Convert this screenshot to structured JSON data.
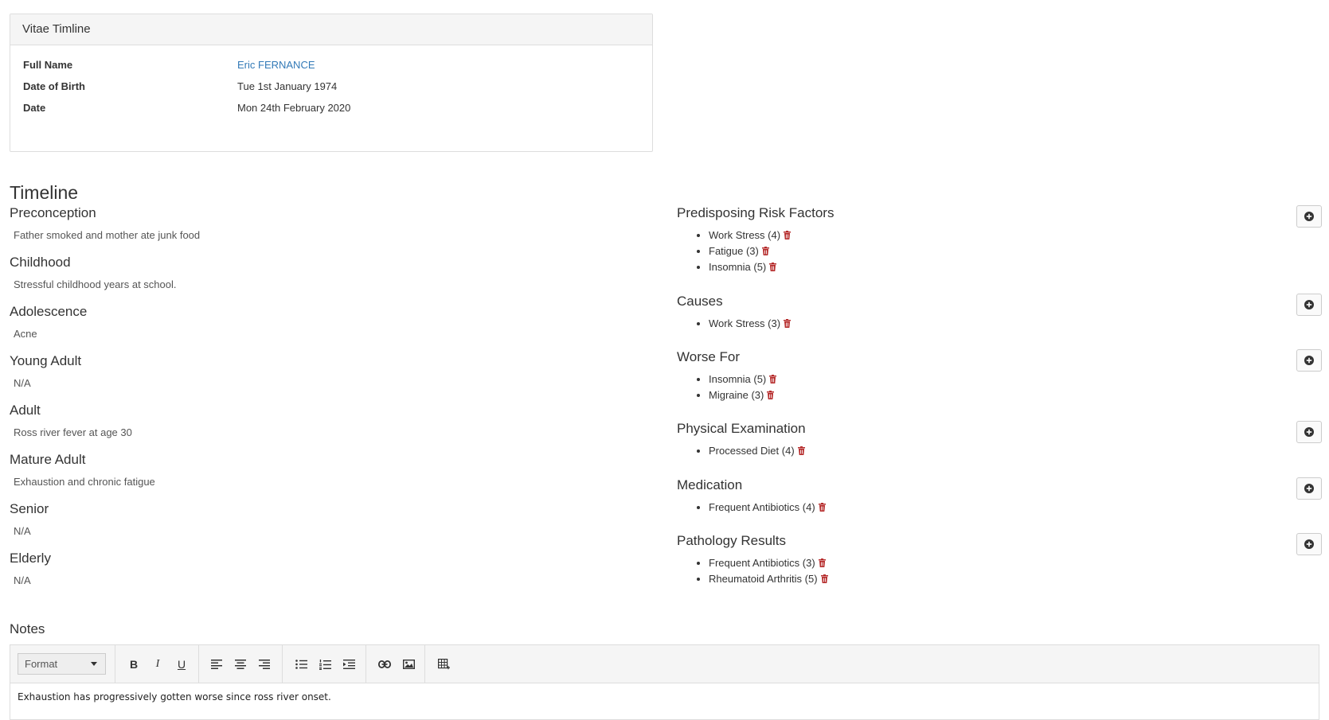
{
  "panel": {
    "title": "Vitae Timline",
    "rows": [
      {
        "label": "Full Name",
        "value": "Eric FERNANCE"
      },
      {
        "label": "Date of Birth",
        "value": "Tue 1st January 1974"
      },
      {
        "label": "Date",
        "value": "Mon 24th February 2020"
      }
    ]
  },
  "timeline": {
    "title": "Timeline",
    "stages": [
      {
        "title": "Preconception",
        "text": "Father smoked and mother ate junk food"
      },
      {
        "title": "Childhood",
        "text": "Stressful childhood years at school."
      },
      {
        "title": "Adolescence",
        "text": "Acne"
      },
      {
        "title": "Young Adult",
        "text": "N/A"
      },
      {
        "title": "Adult",
        "text": "Ross river fever at age 30"
      },
      {
        "title": "Mature Adult",
        "text": "Exhaustion and chronic fatigue"
      },
      {
        "title": "Senior",
        "text": "N/A"
      },
      {
        "title": "Elderly",
        "text": "N/A"
      }
    ]
  },
  "categories": [
    {
      "title": "Predisposing Risk Factors",
      "items": [
        "Work Stress (4)",
        "Fatigue (3)",
        "Insomnia (5)"
      ]
    },
    {
      "title": "Causes",
      "items": [
        "Work Stress (3)"
      ]
    },
    {
      "title": "Worse For",
      "items": [
        "Insomnia (5)",
        "Migraine (3)"
      ]
    },
    {
      "title": "Physical Examination",
      "items": [
        "Processed Diet (4)"
      ]
    },
    {
      "title": "Medication",
      "items": [
        "Frequent Antibiotics (4)"
      ]
    },
    {
      "title": "Pathology Results",
      "items": [
        "Frequent Antibiotics (3)",
        "Rheumatoid Arthritis (5)"
      ]
    }
  ],
  "notes": {
    "title": "Notes",
    "format_label": "Format",
    "toolbar": {
      "bold": "B",
      "italic": "I",
      "underline": "U"
    },
    "content": "Exhaustion has progressively gotten worse since ross river onset."
  },
  "colors": {
    "link": "#337ab7",
    "trash": "#b52a2a",
    "panel_heading_bg": "#f5f5f5"
  },
  "icons": {
    "add": "plus-circle-icon",
    "delete": "trash-icon"
  }
}
